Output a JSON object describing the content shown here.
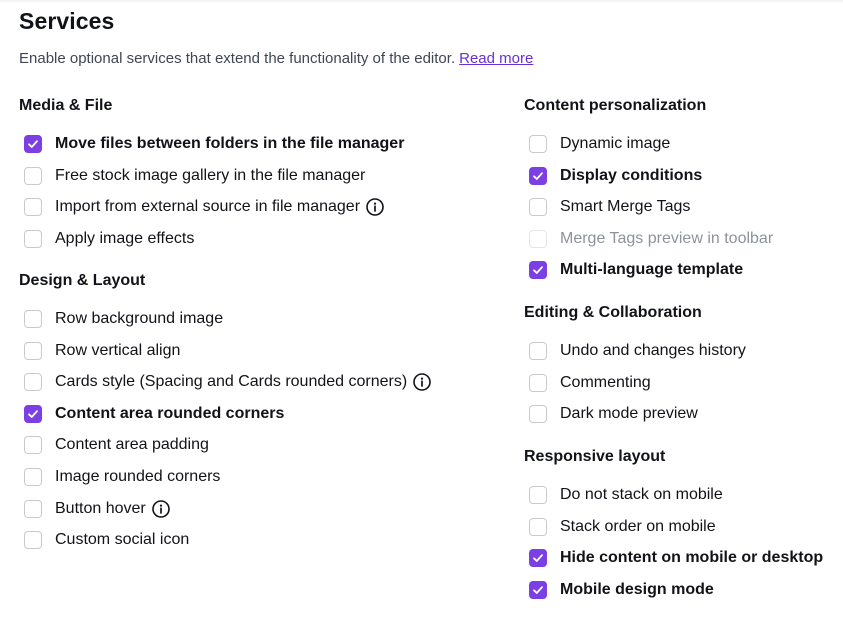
{
  "header": {
    "title": "Services",
    "description": "Enable optional services that extend the functionality of the editor.",
    "read_more": "Read more"
  },
  "colors": {
    "accent": "#7b3fe4",
    "link": "#6b2fd6"
  },
  "groups": {
    "media_file": {
      "title": "Media & File",
      "items": [
        {
          "label": "Move files between folders in the file manager",
          "checked": true
        },
        {
          "label": "Free stock image gallery in the file manager",
          "checked": false
        },
        {
          "label": "Import from external source in file manager",
          "checked": false,
          "info": true
        },
        {
          "label": "Apply image effects",
          "checked": false
        }
      ]
    },
    "design_layout": {
      "title": "Design & Layout",
      "items": [
        {
          "label": "Row background image",
          "checked": false
        },
        {
          "label": "Row vertical align",
          "checked": false
        },
        {
          "label": "Cards style (Spacing and Cards rounded corners)",
          "checked": false,
          "info": true
        },
        {
          "label": "Content area rounded corners",
          "checked": true
        },
        {
          "label": "Content area padding",
          "checked": false
        },
        {
          "label": "Image rounded corners",
          "checked": false
        },
        {
          "label": "Button hover",
          "checked": false,
          "info": true
        },
        {
          "label": "Custom social icon",
          "checked": false
        }
      ]
    },
    "content_personalization": {
      "title": "Content personalization",
      "items": [
        {
          "label": "Dynamic image",
          "checked": false
        },
        {
          "label": "Display conditions",
          "checked": true
        },
        {
          "label": "Smart Merge Tags",
          "checked": false
        },
        {
          "label": "Merge Tags preview in toolbar",
          "checked": false,
          "disabled": true
        },
        {
          "label": "Multi-language template",
          "checked": true
        }
      ]
    },
    "editing_collaboration": {
      "title": "Editing & Collaboration",
      "items": [
        {
          "label": "Undo and changes history",
          "checked": false
        },
        {
          "label": "Commenting",
          "checked": false
        },
        {
          "label": "Dark mode preview",
          "checked": false
        }
      ]
    },
    "responsive_layout": {
      "title": "Responsive layout",
      "items": [
        {
          "label": "Do not stack on mobile",
          "checked": false
        },
        {
          "label": "Stack order on mobile",
          "checked": false
        },
        {
          "label": "Hide content on mobile or desktop",
          "checked": true
        },
        {
          "label": "Mobile design mode",
          "checked": true
        }
      ]
    }
  }
}
